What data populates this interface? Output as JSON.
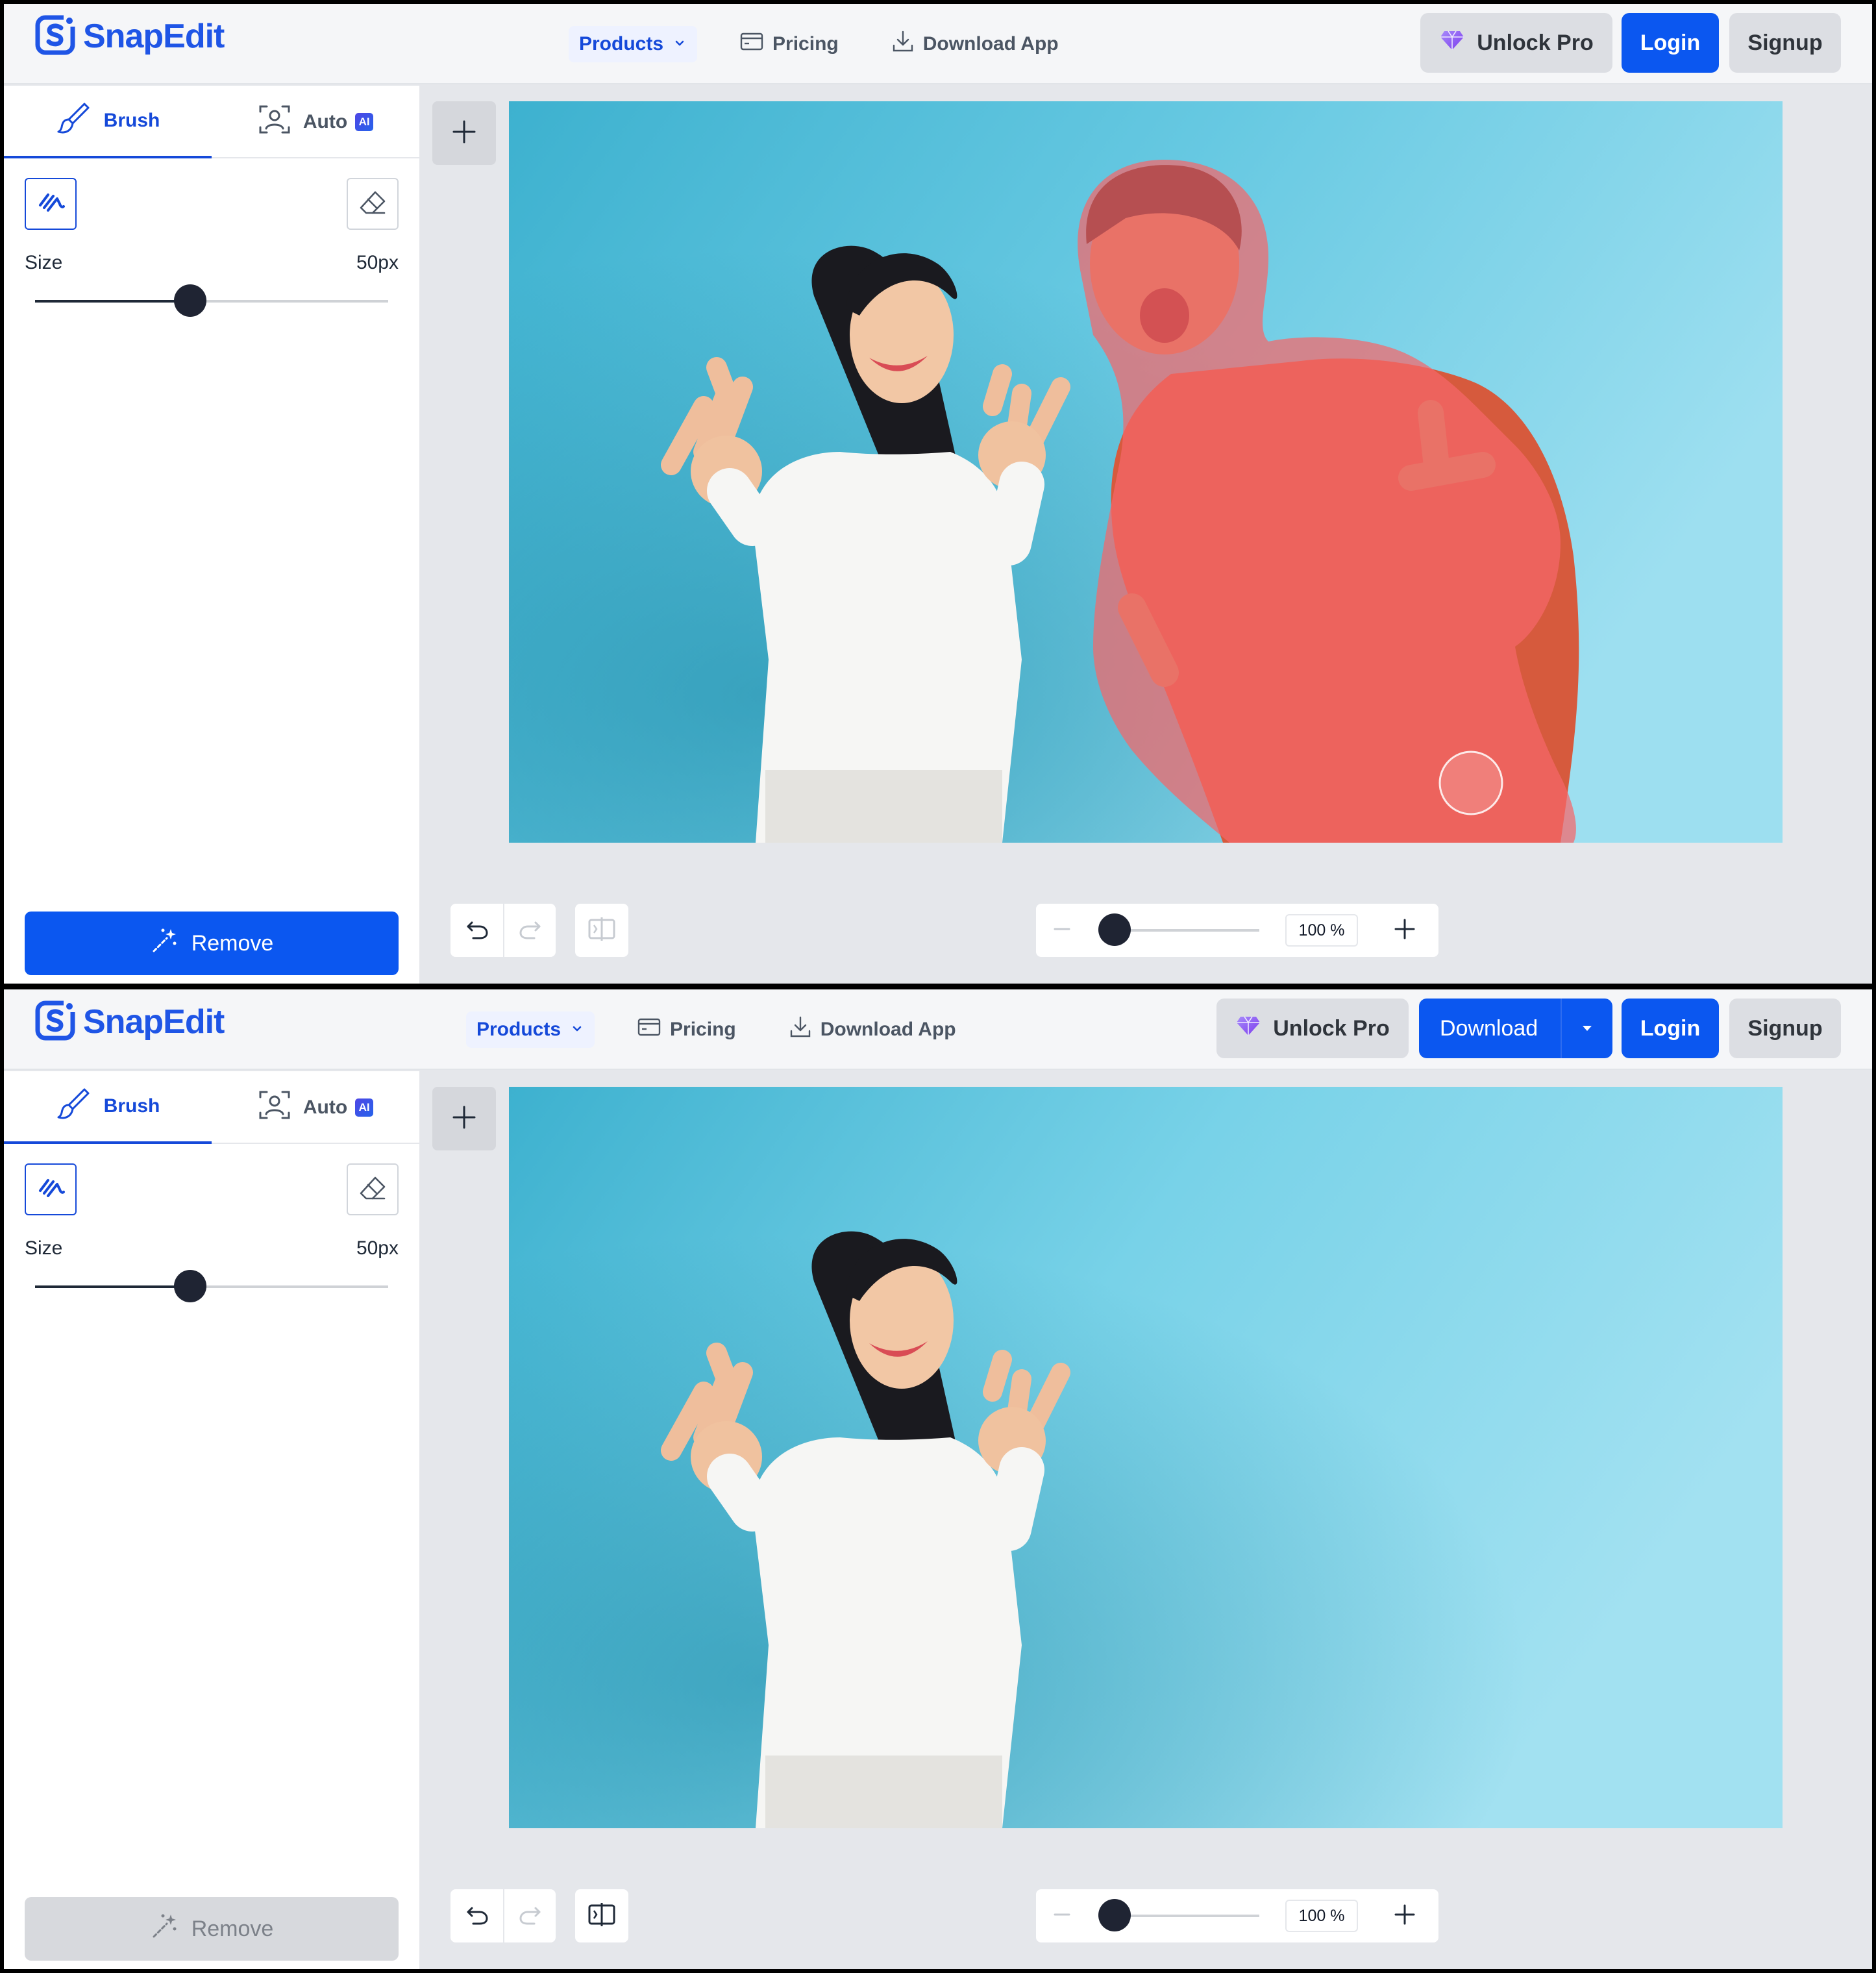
{
  "brand": {
    "name": "SnapEdit",
    "color": "#1f55e6"
  },
  "nav": {
    "products": "Products",
    "pricing": "Pricing",
    "download_app": "Download App"
  },
  "header": {
    "unlock_pro": "Unlock Pro",
    "download": "Download",
    "login": "Login",
    "signup": "Signup"
  },
  "tabs": {
    "brush": "Brush",
    "auto": "Auto",
    "ai_badge": "AI"
  },
  "brush_settings": {
    "size_label": "Size",
    "size_value": "50px",
    "size_level": 0.44
  },
  "actions": {
    "remove": "Remove"
  },
  "zoom": {
    "value": "100 %",
    "level": 0.1
  },
  "colors": {
    "accent": "#0b57f0",
    "mask": "#f5666a",
    "background": "#7fd3e8"
  },
  "icons": [
    "snapedit-logo-icon",
    "chevron-down-icon",
    "pricing-card-icon",
    "download-icon",
    "diamond-icon",
    "brush-tab-icon",
    "auto-select-icon",
    "brush-tool-icon",
    "eraser-icon",
    "magic-wand-icon",
    "plus-icon",
    "undo-icon",
    "redo-icon",
    "compare-icon",
    "minus-icon"
  ],
  "states": [
    {
      "state": "before-removal",
      "mask_visible": true,
      "download_visible": false,
      "remove_enabled": true,
      "compare_enabled": false
    },
    {
      "state": "after-removal",
      "mask_visible": false,
      "download_visible": true,
      "remove_enabled": false,
      "compare_enabled": true
    }
  ]
}
